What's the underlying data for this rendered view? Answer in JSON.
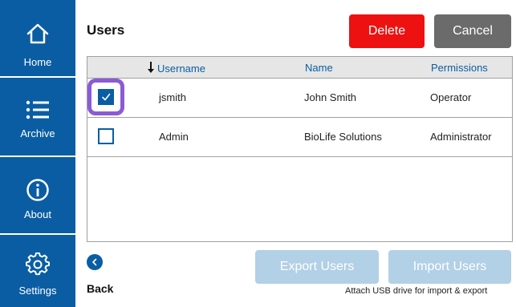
{
  "sidebar": {
    "items": [
      {
        "label": "Home",
        "icon": "home-icon"
      },
      {
        "label": "Archive",
        "icon": "list-icon"
      },
      {
        "label": "About",
        "icon": "info-icon"
      },
      {
        "label": "Settings",
        "icon": "gear-icon"
      }
    ],
    "color": "#0a5da3"
  },
  "header": {
    "title": "Users",
    "delete_label": "Delete",
    "cancel_label": "Cancel",
    "delete_color": "#ee1111",
    "cancel_color": "#6b6b6b"
  },
  "table": {
    "columns": [
      "Username",
      "Name",
      "Permissions"
    ],
    "sort_icon": "sort-down-arrow-icon",
    "rows": [
      {
        "checked": true,
        "username": "jsmith",
        "name": "John Smith",
        "permissions": "Operator"
      },
      {
        "checked": false,
        "username": "Admin",
        "name": "BioLife Solutions",
        "permissions": "Administrator"
      }
    ]
  },
  "footer": {
    "back_label": "Back",
    "export_label": "Export Users",
    "import_label": "Import Users",
    "usb_note": "Attach USB drive for import & export"
  }
}
